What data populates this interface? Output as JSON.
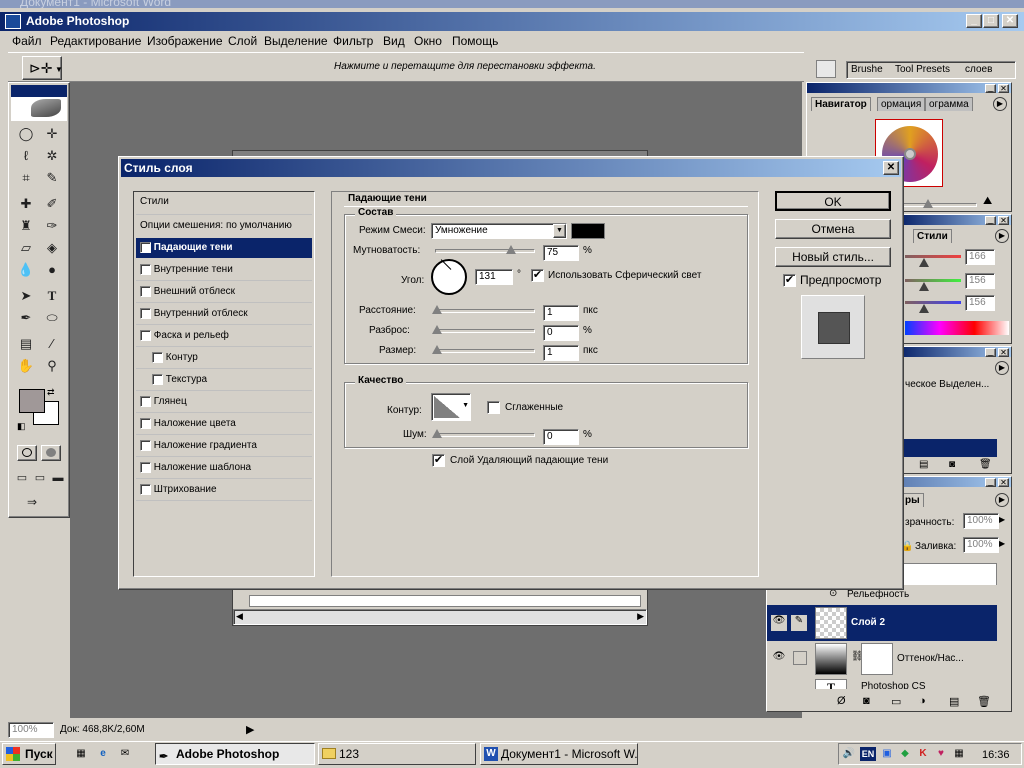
{
  "word_title": "Документ1 - Microsoft Word",
  "app": {
    "title": "Adobe Photoshop"
  },
  "menu": [
    "Файл",
    "Редактирование",
    "Изображение",
    "Слой",
    "Выделение",
    "Фильтр",
    "Вид",
    "Окно",
    "Помощь"
  ],
  "options_bar": {
    "hint": "Нажмите и перетащите для перестановки эффекта."
  },
  "palette_well": {
    "tabs": [
      "Brushe",
      "Tool Presets",
      "слоев"
    ]
  },
  "navigator": {
    "tabs": [
      "Навигатор",
      "ормация",
      "ограмма"
    ]
  },
  "color_panel": {
    "tab": "Стили",
    "values": [
      "166",
      "156",
      "156"
    ]
  },
  "history_panel": {
    "item": "ческое Выделен..."
  },
  "layers_panel": {
    "tab": "ры",
    "opacity_label": "зрачность:",
    "opacity_value": "100%",
    "fill_label": "Заливка:",
    "fill_value": "100%",
    "rows": [
      {
        "name": "Рельефность"
      },
      {
        "name": "Слой 2"
      },
      {
        "name": "Оттенок/Нас..."
      },
      {
        "name": "Photoshop CS"
      }
    ]
  },
  "dialog": {
    "title": "Стиль слоя",
    "styles_header": "Стили",
    "blend_options": "Опции смешения: по умолчанию",
    "items": [
      {
        "label": "Падающие тени",
        "checked": "✔"
      },
      {
        "label": "Внутренние тени",
        "checked": ""
      },
      {
        "label": "Внешний отблеск",
        "checked": ""
      },
      {
        "label": "Внутренний отблеск",
        "checked": ""
      },
      {
        "label": "Фаска и рельеф",
        "checked": ""
      },
      {
        "label": "Контур",
        "checked": ""
      },
      {
        "label": "Текстура",
        "checked": ""
      },
      {
        "label": "Глянец",
        "checked": ""
      },
      {
        "label": "Наложение цвета",
        "checked": ""
      },
      {
        "label": "Наложение градиента",
        "checked": ""
      },
      {
        "label": "Наложение шаблона",
        "checked": ""
      },
      {
        "label": "Штрихование",
        "checked": ""
      }
    ],
    "section_title": "Падающие тени",
    "structure": {
      "title": "Состав",
      "blend_mode_label": "Режим Смеси:",
      "blend_mode_value": "Умножение",
      "opacity_label": "Мутноватость:",
      "opacity_value": "75",
      "opacity_unit": "%",
      "angle_label": "Угол:",
      "angle_value": "131",
      "angle_unit": "°",
      "global_light_label": "Использовать Сферический свет",
      "distance_label": "Расстояние:",
      "distance_value": "1",
      "distance_unit": "пкс",
      "spread_label": "Разброс:",
      "spread_value": "0",
      "spread_unit": "%",
      "size_label": "Размер:",
      "size_value": "1",
      "size_unit": "пкс"
    },
    "quality": {
      "title": "Качество",
      "contour_label": "Контур:",
      "antialias_label": "Сглаженные",
      "noise_label": "Шум:",
      "noise_value": "0",
      "noise_unit": "%"
    },
    "knockout_label": "Слой Удаляющий падающие тени",
    "buttons": {
      "ok": "OK",
      "cancel": "Отмена",
      "new_style": "Новый стиль..."
    },
    "preview_label": "Предпросмотр"
  },
  "status": {
    "zoom": "100%",
    "doc": "Док: 468,8K/2,60M"
  },
  "taskbar": {
    "start": "Пуск",
    "tasks": [
      "Adobe Photoshop",
      "123",
      "Документ1 - Microsoft W..."
    ],
    "lang": "EN",
    "clock": "16:36"
  },
  "colors": {
    "title_dark": "#0a246a",
    "title_light": "#a6caf0",
    "selection": "#0a246a",
    "workspace": "#6e6e6e"
  }
}
